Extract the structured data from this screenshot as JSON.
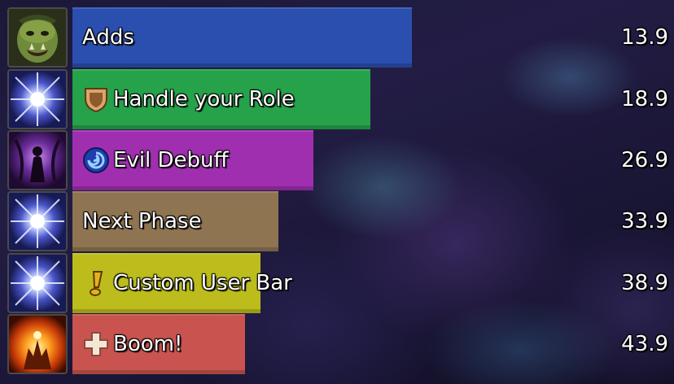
{
  "bars": [
    {
      "label": "Adds",
      "timer": "13.9",
      "color": "#2b4fae",
      "fill": 0.57,
      "icon": "orc-face-icon",
      "glyph": ""
    },
    {
      "label": "Handle your Role",
      "timer": "18.9",
      "color": "#26a24a",
      "fill": 0.5,
      "icon": "arcane-starburst-icon",
      "glyph": "tank-shield-icon"
    },
    {
      "label": "Evil Debuff",
      "timer": "26.9",
      "color": "#a02fb0",
      "fill": 0.405,
      "icon": "shadow-figure-icon",
      "glyph": "blue-swirl-icon"
    },
    {
      "label": "Next Phase",
      "timer": "33.9",
      "color": "#8f7452",
      "fill": 0.345,
      "icon": "arcane-starburst-icon",
      "glyph": ""
    },
    {
      "label": "Custom User Bar",
      "timer": "38.9",
      "color": "#bcbd1c",
      "fill": 0.315,
      "icon": "arcane-starburst-icon",
      "glyph": "exclamation-icon"
    },
    {
      "label": "Boom!",
      "timer": "43.9",
      "color": "#c8534f",
      "fill": 0.29,
      "icon": "fire-explosion-icon",
      "glyph": "healer-cross-icon"
    }
  ]
}
